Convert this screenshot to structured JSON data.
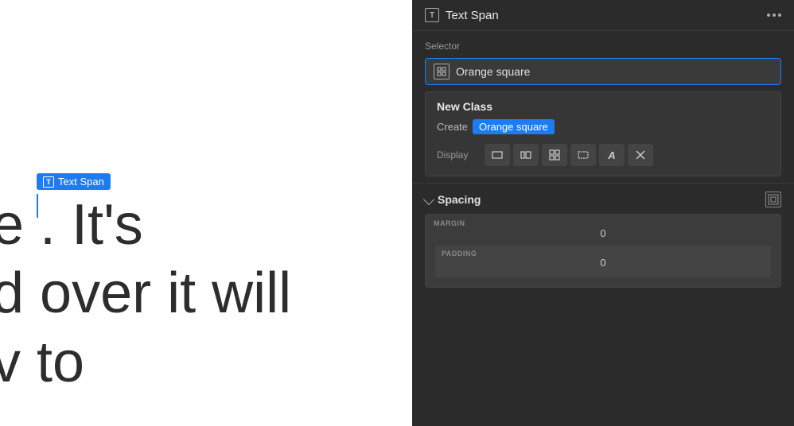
{
  "left": {
    "element_label": "Text Span",
    "canvas_lines": [
      "e . It's",
      "d over it will",
      "v to"
    ]
  },
  "right": {
    "panel_title": "Text Span",
    "panel_title_icon": "T",
    "more_dots": "...",
    "selector_label": "Selector",
    "selector_value": "Orange square",
    "new_class": {
      "title": "New Class",
      "create_label": "Create",
      "class_name": "Orange square"
    },
    "display_label": "Display",
    "display_buttons": [
      "▭",
      "⏸",
      "⊞",
      "▢",
      "|A|",
      "⌀"
    ],
    "spacing": {
      "title": "Spacing",
      "margin_label": "MARGIN",
      "margin_value": "0",
      "padding_label": "PADDING",
      "padding_value": "0"
    }
  }
}
